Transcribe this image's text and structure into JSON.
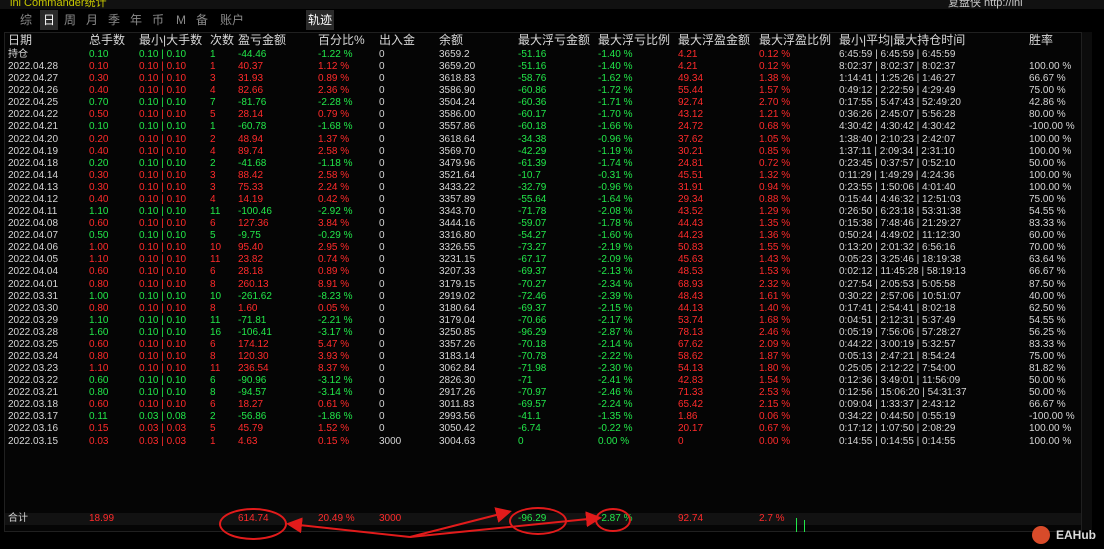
{
  "top": {
    "left_text": "ini Commander统计",
    "right_text": "复盘侠 http://ini Commander.com"
  },
  "tabs": [
    {
      "label": "综",
      "active": false
    },
    {
      "label": "日",
      "active": true
    },
    {
      "label": "周",
      "active": false
    },
    {
      "label": "月",
      "active": false
    },
    {
      "label": "季",
      "active": false
    },
    {
      "label": "年",
      "active": false
    },
    {
      "label": "币",
      "active": false
    },
    {
      "label": "M",
      "active": false
    },
    {
      "label": "备",
      "active": false
    },
    {
      "label": "账户",
      "active": false
    }
  ],
  "trajectory_label": "轨迹",
  "columns": [
    "日期",
    "总手数",
    "最小|大手数",
    "次数",
    "盈亏金额",
    "百分比%",
    "出入金",
    "余额",
    "最大浮亏金额",
    "最大浮亏比例",
    "最大浮盈金额",
    "最大浮盈比例",
    "最小|平均|最大持仓时间",
    "胜率"
  ],
  "rows": [
    [
      "持仓",
      "0.10",
      "0.10 | 0.10",
      "1",
      "-44.46",
      "-1.22 %",
      "0",
      "3659.2",
      "-51.16",
      "-1.40 %",
      "4.21",
      "0.12 %",
      "6:45:59 | 6:45:59 | 6:45:59",
      ""
    ],
    [
      "2022.04.28",
      "0.10",
      "0.10 | 0.10",
      "1",
      "40.37",
      "1.12 %",
      "0",
      "3659.20",
      "-51.16",
      "-1.40 %",
      "4.21",
      "0.12 %",
      "8:02:37 | 8:02:37 | 8:02:37",
      "100.00 %"
    ],
    [
      "2022.04.27",
      "0.30",
      "0.10 | 0.10",
      "3",
      "31.93",
      "0.89 %",
      "0",
      "3618.83",
      "-58.76",
      "-1.62 %",
      "49.34",
      "1.38 %",
      "1:14:41 | 1:25:26 | 1:46:27",
      "66.67 %"
    ],
    [
      "2022.04.26",
      "0.40",
      "0.10 | 0.10",
      "4",
      "82.66",
      "2.36 %",
      "0",
      "3586.90",
      "-60.86",
      "-1.72 %",
      "55.44",
      "1.57 %",
      "0:49:12 | 2:22:59 | 4:29:49",
      "75.00 %"
    ],
    [
      "2022.04.25",
      "0.70",
      "0.10 | 0.10",
      "7",
      "-81.76",
      "-2.28 %",
      "0",
      "3504.24",
      "-60.36",
      "-1.71 %",
      "92.74",
      "2.70 %",
      "0:17:55 | 5:47:43 | 52:49:20",
      "42.86 %"
    ],
    [
      "2022.04.22",
      "0.50",
      "0.10 | 0.10",
      "5",
      "28.14",
      "0.79 %",
      "0",
      "3586.00",
      "-60.17",
      "-1.70 %",
      "43.12",
      "1.21 %",
      "0:36:26 | 2:45:07 | 5:56:28",
      "80.00 %"
    ],
    [
      "2022.04.21",
      "0.10",
      "0.10 | 0.10",
      "1",
      "-60.78",
      "-1.68 %",
      "0",
      "3557.86",
      "-60.18",
      "-1.66 %",
      "24.72",
      "0.68 %",
      "4:30:42 | 4:30:42 | 4:30:42",
      "-100.00 %"
    ],
    [
      "2022.04.20",
      "0.20",
      "0.10 | 0.10",
      "2",
      "48.94",
      "1.37 %",
      "0",
      "3618.64",
      "-34.38",
      "-0.96 %",
      "37.62",
      "1.05 %",
      "1:38:40 | 2:10:23 | 2:42:07",
      "100.00 %"
    ],
    [
      "2022.04.19",
      "0.40",
      "0.10 | 0.10",
      "4",
      "89.74",
      "2.58 %",
      "0",
      "3569.70",
      "-42.29",
      "-1.19 %",
      "30.21",
      "0.85 %",
      "1:37:11 | 2:09:34 | 2:31:10",
      "100.00 %"
    ],
    [
      "2022.04.18",
      "0.20",
      "0.10 | 0.10",
      "2",
      "-41.68",
      "-1.18 %",
      "0",
      "3479.96",
      "-61.39",
      "-1.74 %",
      "24.81",
      "0.72 %",
      "0:23:45 | 0:37:57 | 0:52:10",
      "50.00 %"
    ],
    [
      "2022.04.14",
      "0.30",
      "0.10 | 0.10",
      "3",
      "88.42",
      "2.58 %",
      "0",
      "3521.64",
      "-10.7",
      "-0.31 %",
      "45.51",
      "1.32 %",
      "0:11:29 | 1:49:29 | 4:24:36",
      "100.00 %"
    ],
    [
      "2022.04.13",
      "0.30",
      "0.10 | 0.10",
      "3",
      "75.33",
      "2.24 %",
      "0",
      "3433.22",
      "-32.79",
      "-0.96 %",
      "31.91",
      "0.94 %",
      "0:23:55 | 1:50:06 | 4:01:40",
      "100.00 %"
    ],
    [
      "2022.04.12",
      "0.40",
      "0.10 | 0.10",
      "4",
      "14.19",
      "0.42 %",
      "0",
      "3357.89",
      "-55.64",
      "-1.64 %",
      "29.34",
      "0.88 %",
      "0:15:44 | 4:46:32 | 12:51:03",
      "75.00 %"
    ],
    [
      "2022.04.11",
      "1.10",
      "0.10 | 0.10",
      "11",
      "-100.46",
      "-2.92 %",
      "0",
      "3343.70",
      "-71.78",
      "-2.08 %",
      "43.52",
      "1.29 %",
      "0:26:50 | 6:23:18 | 53:31:38",
      "54.55 %"
    ],
    [
      "2022.04.08",
      "0.60",
      "0.10 | 0.10",
      "6",
      "127.36",
      "3.84 %",
      "0",
      "3444.16",
      "-59.07",
      "-1.78 %",
      "44.43",
      "1.35 %",
      "0:15:38 | 7:48:46 | 21:29:27",
      "83.33 %"
    ],
    [
      "2022.04.07",
      "0.50",
      "0.10 | 0.10",
      "5",
      "-9.75",
      "-0.29 %",
      "0",
      "3316.80",
      "-54.27",
      "-1.60 %",
      "44.23",
      "1.36 %",
      "0:50:24 | 4:49:02 | 11:12:30",
      "60.00 %"
    ],
    [
      "2022.04.06",
      "1.00",
      "0.10 | 0.10",
      "10",
      "95.40",
      "2.95 %",
      "0",
      "3326.55",
      "-73.27",
      "-2.19 %",
      "50.83",
      "1.55 %",
      "0:13:20 | 2:01:32 | 6:56:16",
      "70.00 %"
    ],
    [
      "2022.04.05",
      "1.10",
      "0.10 | 0.10",
      "11",
      "23.82",
      "0.74 %",
      "0",
      "3231.15",
      "-67.17",
      "-2.09 %",
      "45.63",
      "1.43 %",
      "0:05:23 | 3:25:46 | 18:19:38",
      "63.64 %"
    ],
    [
      "2022.04.04",
      "0.60",
      "0.10 | 0.10",
      "6",
      "28.18",
      "0.89 %",
      "0",
      "3207.33",
      "-69.37",
      "-2.13 %",
      "48.53",
      "1.53 %",
      "0:02:12 | 11:45:28 | 58:19:13",
      "66.67 %"
    ],
    [
      "2022.04.01",
      "0.80",
      "0.10 | 0.10",
      "8",
      "260.13",
      "8.91 %",
      "0",
      "3179.15",
      "-70.27",
      "-2.34 %",
      "68.93",
      "2.32 %",
      "0:27:54 | 2:05:53 | 5:05:58",
      "87.50 %"
    ],
    [
      "2022.03.31",
      "1.00",
      "0.10 | 0.10",
      "10",
      "-261.62",
      "-8.23 %",
      "0",
      "2919.02",
      "-72.46",
      "-2.39 %",
      "48.43",
      "1.61 %",
      "0:30:22 | 2:57:06 | 10:51:07",
      "40.00 %"
    ],
    [
      "2022.03.30",
      "0.80",
      "0.10 | 0.10",
      "8",
      "1.60",
      "0.05 %",
      "0",
      "3180.64",
      "-69.37",
      "-2.15 %",
      "44.13",
      "1.40 %",
      "0:17:41 | 2:54:41 | 8:02:18",
      "62.50 %"
    ],
    [
      "2022.03.29",
      "1.10",
      "0.10 | 0.10",
      "11",
      "-71.81",
      "-2.21 %",
      "0",
      "3179.04",
      "-70.66",
      "-2.17 %",
      "53.74",
      "1.68 %",
      "0:04:51 | 2:12:31 | 5:37:49",
      "54.55 %"
    ],
    [
      "2022.03.28",
      "1.60",
      "0.10 | 0.10",
      "16",
      "-106.41",
      "-3.17 %",
      "0",
      "3250.85",
      "-96.29",
      "-2.87 %",
      "78.13",
      "2.46 %",
      "0:05:19 | 7:56:06 | 57:28:27",
      "56.25 %"
    ],
    [
      "2022.03.25",
      "0.60",
      "0.10 | 0.10",
      "6",
      "174.12",
      "5.47 %",
      "0",
      "3357.26",
      "-70.18",
      "-2.14 %",
      "67.62",
      "2.09 %",
      "0:44:22 | 3:00:19 | 5:32:57",
      "83.33 %"
    ],
    [
      "2022.03.24",
      "0.80",
      "0.10 | 0.10",
      "8",
      "120.30",
      "3.93 %",
      "0",
      "3183.14",
      "-70.78",
      "-2.22 %",
      "58.62",
      "1.87 %",
      "0:05:13 | 2:47:21 | 8:54:24",
      "75.00 %"
    ],
    [
      "2022.03.23",
      "1.10",
      "0.10 | 0.10",
      "11",
      "236.54",
      "8.37 %",
      "0",
      "3062.84",
      "-71.98",
      "-2.30 %",
      "54.13",
      "1.80 %",
      "0:25:05 | 2:12:22 | 7:54:00",
      "81.82 %"
    ],
    [
      "2022.03.22",
      "0.60",
      "0.10 | 0.10",
      "6",
      "-90.96",
      "-3.12 %",
      "0",
      "2826.30",
      "-71",
      "-2.41 %",
      "42.83",
      "1.54 %",
      "0:12:36 | 3:49:01 | 11:56:09",
      "50.00 %"
    ],
    [
      "2022.03.21",
      "0.80",
      "0.10 | 0.10",
      "8",
      "-94.57",
      "-3.14 %",
      "0",
      "2917.26",
      "-70.97",
      "-2.46 %",
      "71.33",
      "2.53 %",
      "0:12:56 | 15:06:20 | 54:31:37",
      "50.00 %"
    ],
    [
      "2022.03.18",
      "0.60",
      "0.10 | 0.10",
      "6",
      "18.27",
      "0.61 %",
      "0",
      "3011.83",
      "-69.57",
      "-2.24 %",
      "65.42",
      "2.15 %",
      "0:09:04 | 1:33:37 | 2:43:12",
      "66.67 %"
    ],
    [
      "2022.03.17",
      "0.11",
      "0.03 | 0.08",
      "2",
      "-56.86",
      "-1.86 %",
      "0",
      "2993.56",
      "-41.1",
      "-1.35 %",
      "1.86",
      "0.06 %",
      "0:34:22 | 0:44:50 | 0:55:19",
      "-100.00 %"
    ],
    [
      "2022.03.16",
      "0.15",
      "0.03 | 0.03",
      "5",
      "45.79",
      "1.52 %",
      "0",
      "3050.42",
      "-6.74",
      "-0.22 %",
      "20.17",
      "0.67 %",
      "0:17:12 | 1:07:50 | 2:08:29",
      "100.00 %"
    ],
    [
      "2022.03.15",
      "0.03",
      "0.03 | 0.03",
      "1",
      "4.63",
      "0.15 %",
      "3000",
      "3004.63",
      "0",
      "0.00 %",
      "0",
      "0.00 %",
      "0:14:55 | 0:14:55 | 0:14:55",
      "100.00 %"
    ]
  ],
  "total": [
    "合计",
    "18.99",
    "",
    "",
    "614.74",
    "20.49 %",
    "3000",
    "",
    "-96.29",
    "-2.87 %",
    "92.74",
    "2.7 %",
    "",
    ""
  ],
  "logo_text": "EAHub",
  "colors": {
    "profit": "#ff2b2b",
    "loss": "#22e84a",
    "annotation": "#e21b1b"
  }
}
